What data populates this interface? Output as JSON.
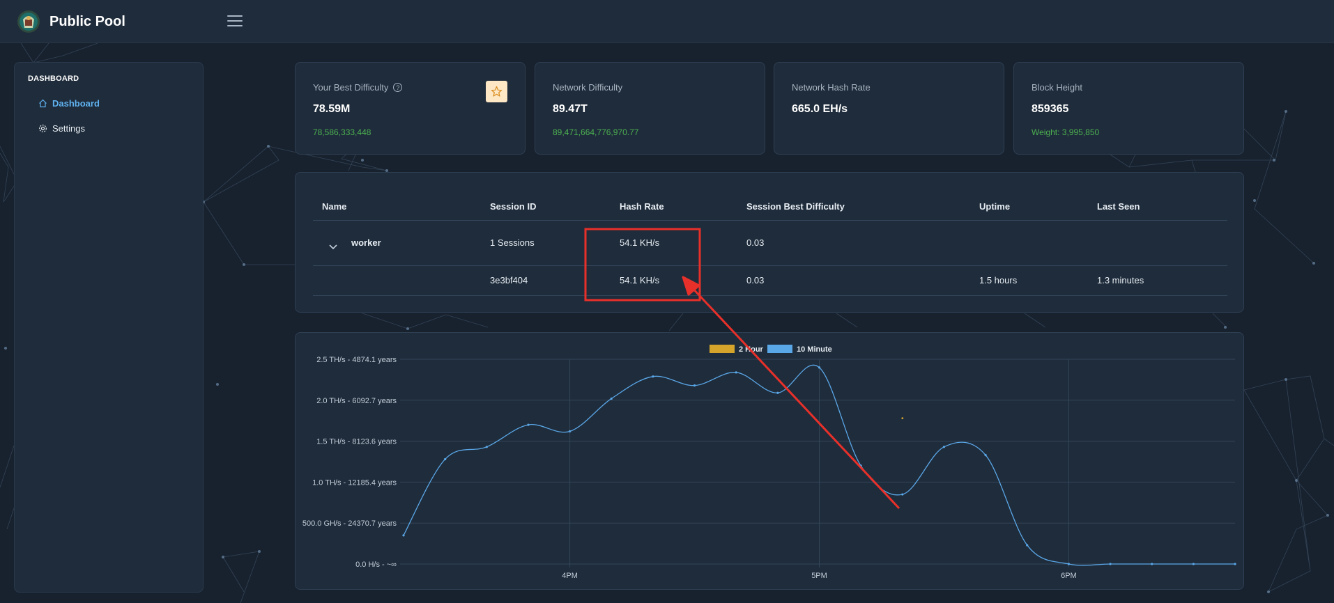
{
  "app": {
    "title": "Public Pool"
  },
  "sidebar": {
    "section": "DASHBOARD",
    "items": [
      {
        "label": "Dashboard",
        "icon": "home-icon",
        "active": true
      },
      {
        "label": "Settings",
        "icon": "gear-icon",
        "active": false
      }
    ]
  },
  "cards": {
    "best_difficulty": {
      "label": "Your Best Difficulty",
      "value": "78.59M",
      "sub": "78,586,333,448"
    },
    "network_difficulty": {
      "label": "Network Difficulty",
      "value": "89.47T",
      "sub": "89,471,664,776,970.77"
    },
    "network_hashrate": {
      "label": "Network Hash Rate",
      "value": "665.0 EH/s"
    },
    "block_height": {
      "label": "Block Height",
      "value": "859365",
      "sub": "Weight: 3,995,850"
    }
  },
  "table": {
    "headers": [
      "Name",
      "Session ID",
      "Hash Rate",
      "Session Best Difficulty",
      "Uptime",
      "Last Seen"
    ],
    "worker": {
      "name": "worker",
      "sessions": "1 Sessions",
      "hashrate": "54.1 KH/s",
      "best": "0.03"
    },
    "session": {
      "id": "3e3bf404",
      "hashrate": "54.1 KH/s",
      "best": "0.03",
      "uptime": "1.5 hours",
      "last_seen": "1.3 minutes"
    }
  },
  "colors": {
    "accent": "#5fb2f0",
    "success": "#4caf50",
    "series_2h": "#d4a52a",
    "series_10m": "#5aa7e8",
    "annotation": "#e8302a"
  },
  "chart_data": {
    "type": "line",
    "legend": [
      {
        "name": "2 Hour",
        "color": "#d4a52a"
      },
      {
        "name": "10 Minute",
        "color": "#5aa7e8"
      }
    ],
    "y_ticks": [
      "0.0 H/s - ~∞",
      "500.0 GH/s - 24370.7 years",
      "1.0 TH/s - 12185.4 years",
      "1.5 TH/s - 8123.6 years",
      "2.0 TH/s - 6092.7 years",
      "2.5 TH/s - 4874.1 years"
    ],
    "y_tick_values": [
      0,
      0.5,
      1.0,
      1.5,
      2.0,
      2.5
    ],
    "x_ticks": [
      "4PM",
      "5PM",
      "6PM"
    ],
    "x_tick_minutes": [
      0,
      60,
      120
    ],
    "ylim": [
      0,
      2.5
    ],
    "xlim_minutes": [
      -40,
      160
    ],
    "series": [
      {
        "name": "10 Minute",
        "x_minutes": [
          -40,
          -30,
          -20,
          -10,
          0,
          10,
          20,
          30,
          40,
          50,
          60,
          70,
          80,
          90,
          100,
          110,
          120,
          130,
          140,
          150,
          160
        ],
        "values": [
          0.35,
          1.28,
          1.43,
          1.7,
          1.62,
          2.02,
          2.29,
          2.18,
          2.34,
          2.09,
          2.4,
          1.2,
          0.85,
          1.43,
          1.33,
          0.23,
          0.0,
          0.0,
          0.0,
          0.0,
          0.0
        ]
      },
      {
        "name": "2 Hour",
        "x_minutes": [
          80
        ],
        "values": [
          1.78
        ]
      }
    ]
  }
}
